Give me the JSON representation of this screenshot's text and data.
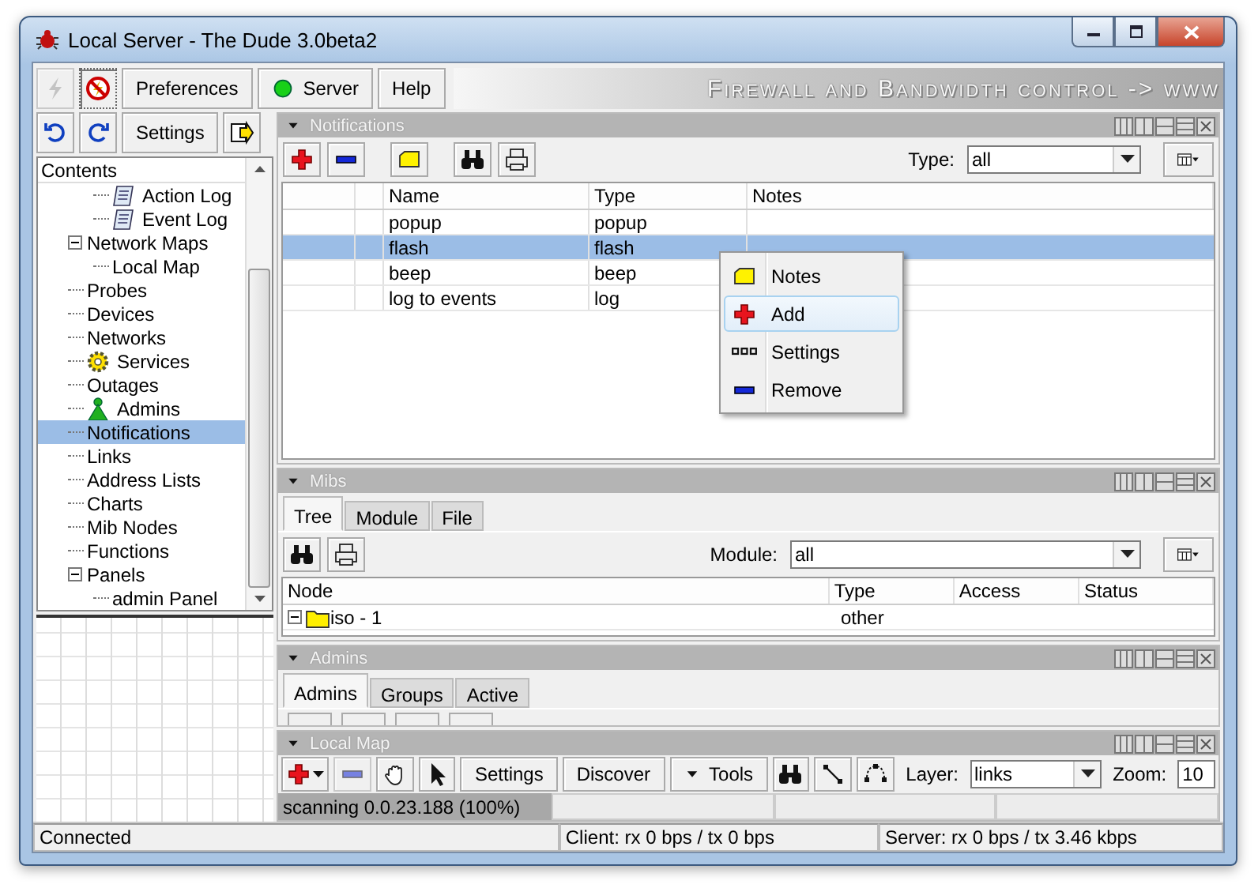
{
  "window": {
    "title": "Local Server - The Dude 3.0beta2"
  },
  "toolbar": {
    "buttons": [
      {
        "kind": "connect",
        "disabled": true
      },
      {
        "kind": "disconnect",
        "disabled": false
      },
      {
        "kind": "text",
        "label": "Preferences",
        "disabled": false
      },
      {
        "kind": "server",
        "label": "Server",
        "disabled": false
      },
      {
        "kind": "text",
        "label": "Help",
        "disabled": false
      }
    ],
    "banner": "Firewall and Bandwidth control -> www"
  },
  "nav_toolbar": {
    "buttons": [
      {
        "kind": "undo"
      },
      {
        "kind": "redo"
      },
      {
        "kind": "text",
        "label": "Settings"
      },
      {
        "kind": "exit"
      }
    ]
  },
  "tree": {
    "header": "Contents",
    "items": [
      {
        "children": [
          {
            "label": "Action Log",
            "kind": "log",
            "selected": false
          },
          {
            "label": "Event Log",
            "kind": "log",
            "selected": false
          }
        ]
      },
      {
        "label": "Network Maps",
        "kind": "plain",
        "expanded": true,
        "selected": false,
        "children": [
          {
            "label": "Local Map",
            "kind": "plain",
            "selected": false
          }
        ]
      },
      {
        "label": "Probes",
        "kind": "plain",
        "selected": false
      },
      {
        "label": "Devices",
        "kind": "plain",
        "selected": false
      },
      {
        "label": "Networks",
        "kind": "plain",
        "selected": false
      },
      {
        "label": "Services",
        "kind": "services",
        "selected": false
      },
      {
        "label": "Outages",
        "kind": "plain",
        "selected": false
      },
      {
        "label": "Admins",
        "kind": "admins",
        "selected": false
      },
      {
        "label": "Notifications",
        "kind": "plain",
        "selected": true
      },
      {
        "label": "Links",
        "kind": "plain",
        "selected": false
      },
      {
        "label": "Address Lists",
        "kind": "plain",
        "selected": false
      },
      {
        "label": "Charts",
        "kind": "plain",
        "selected": false
      },
      {
        "label": "Mib Nodes",
        "kind": "plain",
        "selected": false
      },
      {
        "label": "Functions",
        "kind": "plain",
        "selected": false
      },
      {
        "label": "Panels",
        "kind": "plain",
        "expanded": true,
        "selected": false,
        "children": [
          {
            "label": "admin Panel",
            "kind": "plain",
            "selected": false
          }
        ]
      }
    ]
  },
  "notifications": {
    "title": "Notifications",
    "tools": [
      {
        "kind": "add"
      },
      {
        "kind": "remove"
      },
      {
        "kind": "notes"
      },
      {
        "kind": "find"
      },
      {
        "kind": "print"
      }
    ],
    "type_label": "Type:",
    "type_value": "all",
    "columns": [
      "Name",
      "Type",
      "Notes"
    ],
    "rows": [
      {
        "name": "popup",
        "type": "popup",
        "selected": false
      },
      {
        "name": "flash",
        "type": "flash",
        "selected": true
      },
      {
        "name": "beep",
        "type": "beep",
        "selected": false
      },
      {
        "name": "log to events",
        "type": "log",
        "selected": false
      }
    ]
  },
  "context_menu": {
    "items": [
      {
        "kind": "notes",
        "label": "Notes",
        "selected": false
      },
      {
        "kind": "add",
        "label": "Add",
        "selected": true
      },
      {
        "kind": "settings",
        "label": "Settings",
        "selected": false
      },
      {
        "kind": "remove",
        "label": "Remove",
        "selected": false
      }
    ]
  },
  "mibs": {
    "title": "Mibs",
    "tabs": [
      {
        "label": "Tree",
        "selected": true
      },
      {
        "label": "Module",
        "selected": false
      },
      {
        "label": "File",
        "selected": false
      }
    ],
    "tools": [
      {
        "kind": "find"
      },
      {
        "kind": "print"
      }
    ],
    "module_label": "Module:",
    "module_value": "all",
    "columns": [
      "Node",
      "Type",
      "Access",
      "Status"
    ],
    "rows": [
      {
        "node": "iso - 1",
        "type": "other",
        "expanded": true
      }
    ]
  },
  "admins": {
    "title": "Admins",
    "tabs": [
      {
        "label": "Admins",
        "selected": true
      },
      {
        "label": "Groups",
        "selected": false
      },
      {
        "label": "Active",
        "selected": false
      }
    ]
  },
  "local_map": {
    "title": "Local Map",
    "tools": [
      {
        "kind": "add_menu",
        "disabled": false
      },
      {
        "kind": "remove",
        "disabled": true
      },
      {
        "kind": "hand",
        "disabled": false
      },
      {
        "kind": "pointer",
        "disabled": false
      },
      {
        "kind": "text",
        "label": "Settings",
        "disabled": false
      },
      {
        "kind": "text",
        "label": "Discover",
        "disabled": false
      },
      {
        "kind": "menu",
        "label": "Tools",
        "disabled": false
      },
      {
        "kind": "find",
        "disabled": false
      },
      {
        "kind": "link",
        "disabled": false
      },
      {
        "kind": "curve",
        "disabled": false
      }
    ],
    "layer_label": "Layer:",
    "layer_value": "links",
    "zoom_label": "Zoom:",
    "zoom_value": "10",
    "progress": "scanning 0.0.23.188 (100%)"
  },
  "status_bar": [
    "Connected",
    "Client: rx 0 bps / tx 0 bps",
    "Server: rx 0 bps / tx 3.46 kbps"
  ]
}
